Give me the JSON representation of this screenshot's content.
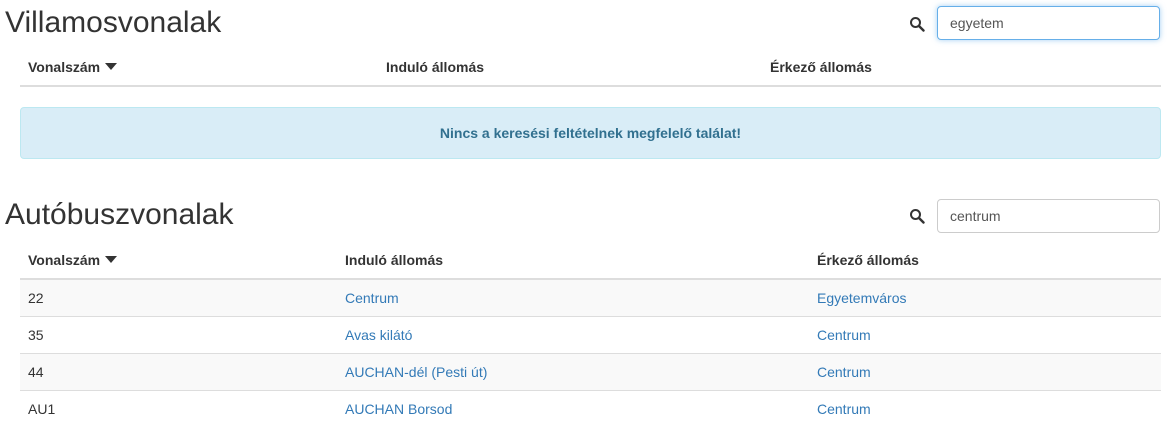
{
  "tram": {
    "title": "Villamosvonalak",
    "search": {
      "value": "egyetem",
      "icon": "search-icon"
    },
    "columns": [
      "Vonalszám",
      "Induló állomás",
      "Érkező állomás"
    ],
    "empty_message": "Nincs a keresési feltételnek megfelelő találat!"
  },
  "bus": {
    "title": "Autóbuszvonalak",
    "search": {
      "value": "centrum",
      "icon": "search-icon"
    },
    "columns": [
      "Vonalszám",
      "Induló állomás",
      "Érkező állomás"
    ],
    "rows": [
      {
        "number": "22",
        "from": "Centrum",
        "to": "Egyetemváros"
      },
      {
        "number": "35",
        "from": "Avas kilátó",
        "to": "Centrum"
      },
      {
        "number": "44",
        "from": "AUCHAN-dél (Pesti út)",
        "to": "Centrum"
      },
      {
        "number": "AU1",
        "from": "AUCHAN Borsod",
        "to": "Centrum"
      }
    ]
  },
  "colors": {
    "link": "#337ab7",
    "alert_bg": "#d9edf7",
    "alert_text": "#31708f",
    "stripe": "#f9f9f9"
  }
}
